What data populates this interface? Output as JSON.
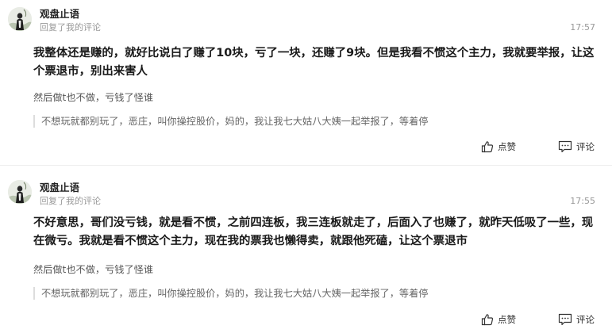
{
  "comments": [
    {
      "username": "观盘止语",
      "action": "回复了我的评论",
      "time": "17:57",
      "content": "我整体还是赚的，就好比说白了赚了10块，亏了一块，还赚了9块。但是我看不惯这个主力，我就要举报，让这个票退市，别出来害人",
      "reply_text": "然后做t也不做，亏钱了怪谁",
      "quoted_text": "不想玩就都别玩了，恶庄，叫你操控股价，妈的，我让我七大姑八大姨一起举报了，等着停",
      "like_label": "点赞",
      "comment_label": "评论"
    },
    {
      "username": "观盘止语",
      "action": "回复了我的评论",
      "time": "17:55",
      "content": "不好意思，哥们没亏钱，就是看不惯，之前四连板，我三连板就走了，后面入了也赚了，就昨天低吸了一些，现在微亏。我就是看不惯这个主力，现在我的票我也懒得卖，就跟他死磕，让这个票退市",
      "reply_text": "然后做t也不做，亏钱了怪谁",
      "quoted_text": "不想玩就都别玩了，恶庄，叫你操控股价，妈的，我让我七大姑八大姨一起举报了，等着停",
      "like_label": "点赞",
      "comment_label": "评论"
    }
  ],
  "icons": {
    "like": "thumbs-up-icon",
    "comment": "comment-bubble-icon",
    "avatar": "avatar-image"
  }
}
